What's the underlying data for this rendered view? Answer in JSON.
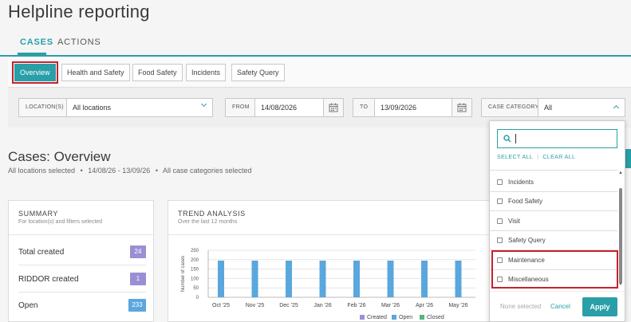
{
  "page": {
    "title": "Helpline reporting"
  },
  "tabs": [
    {
      "label": "CASES",
      "active": true
    },
    {
      "label": "ACTIONS",
      "active": false
    }
  ],
  "subnav": [
    {
      "label": "Overview",
      "active": true
    },
    {
      "label": "Health and Safety"
    },
    {
      "label": "Food Safety"
    },
    {
      "label": "Incidents"
    },
    {
      "label": "Safety Query"
    }
  ],
  "filters": {
    "location_label": "LOCATION(S)",
    "location_value": "All locations",
    "from_label": "FROM",
    "from_value": "14/08/2026",
    "to_label": "TO",
    "to_value": "13/09/2026",
    "category_label": "CASE CATEGORY",
    "category_value": "All"
  },
  "section": {
    "title": "Cases: Overview",
    "sub_locations": "All locations selected",
    "sub_bullet": "•",
    "sub_dates": "14/08/26 - 13/09/26",
    "sub_categories": "All case categories selected"
  },
  "summary": {
    "title": "SUMMARY",
    "subtitle": "For location(s) and filters selected",
    "rows": [
      {
        "label": "Total created",
        "value": "24",
        "color": "#9b8fd4"
      },
      {
        "label": "RIDDOR created",
        "value": "1",
        "color": "#9b8fd4"
      },
      {
        "label": "Open",
        "value": "233",
        "color": "#5aa7dd"
      }
    ]
  },
  "trend": {
    "title": "TREND ANALYSIS",
    "subtitle": "Over the last 12 months"
  },
  "chart_data": {
    "type": "bar",
    "categories": [
      "Oct '25",
      "Nov '25",
      "Dec '25",
      "Jan '26",
      "Feb '26",
      "Mar '26",
      "Apr '26",
      "May '26"
    ],
    "series": [
      {
        "name": "Open",
        "values": [
          195,
          195,
          195,
          195,
          195,
          195,
          195,
          195
        ],
        "color": "#5aa7dd"
      }
    ],
    "legend": [
      "Created",
      "Open",
      "Closed"
    ],
    "legend_colors": [
      "#9b8fd4",
      "#5aa7dd",
      "#4fb87a"
    ],
    "ylabel": "Number of cases",
    "yticks": [
      "250",
      "200",
      "150",
      "100",
      "50",
      "0"
    ],
    "ylim": [
      0,
      250
    ]
  },
  "dropdown": {
    "select_all": "SELECT ALL",
    "separator": "|",
    "clear_all": "CLEAR ALL",
    "items": [
      "Incidents",
      "Food Safety",
      "Visit",
      "Safety Query",
      "Maintenance",
      "Miscellaneous"
    ],
    "none_selected": "None selected",
    "cancel": "Cancel",
    "apply": "Apply"
  },
  "colors": {
    "accent": "#2a9fa8",
    "highlight": "#c9202e"
  },
  "icons": [
    "search-icon",
    "calendar-icon",
    "chevron-down-icon",
    "chevron-up-icon"
  ]
}
